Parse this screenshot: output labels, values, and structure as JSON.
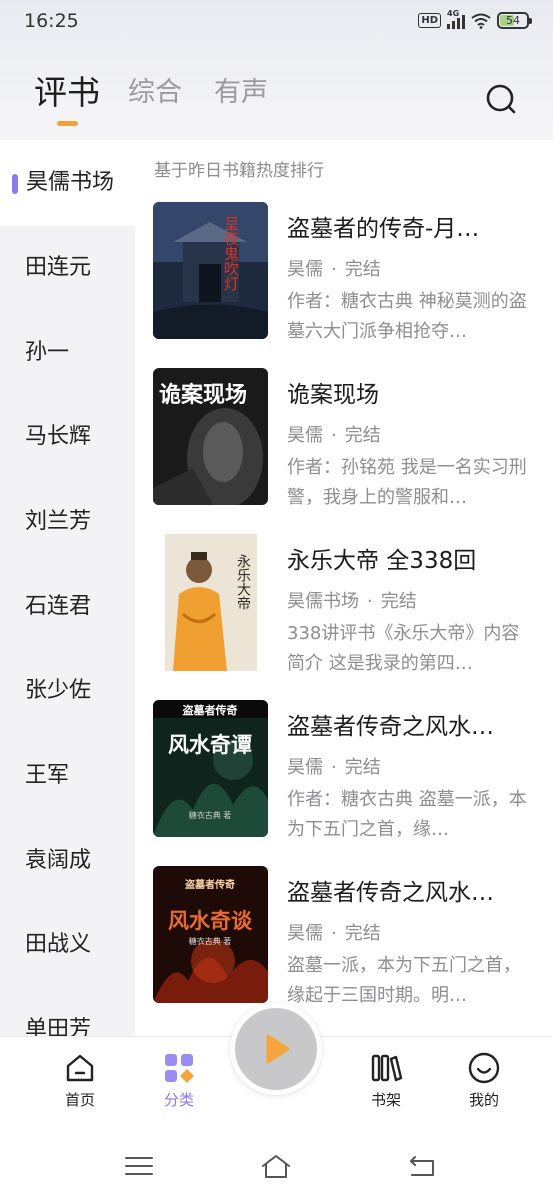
{
  "status_bar": {
    "time": "16:25",
    "hd": "HD",
    "network": "4G",
    "battery": "54",
    "battery_level": 0.54
  },
  "top_tabs": [
    {
      "label": "评书",
      "active": true
    },
    {
      "label": "综合",
      "active": false
    },
    {
      "label": "有声",
      "active": false
    }
  ],
  "colors": {
    "accent": "#8a78ee",
    "tab_indicator": "#f0a23e"
  },
  "subtitle": "基于昨日书籍热度排行",
  "sidebar": {
    "items": [
      {
        "label": "昊儒书场",
        "active": true
      },
      {
        "label": "田连元"
      },
      {
        "label": "孙一"
      },
      {
        "label": "马长辉"
      },
      {
        "label": "刘兰芳"
      },
      {
        "label": "石连君"
      },
      {
        "label": "张少佐"
      },
      {
        "label": "王军"
      },
      {
        "label": "袁阔成"
      },
      {
        "label": "田战义"
      },
      {
        "label": "单田芳"
      }
    ]
  },
  "books": [
    {
      "title": "盗墓者的传奇-月…",
      "author": "昊儒",
      "status": "完结",
      "desc": "作者：糖衣古典 神秘莫测的盗墓六大门派争相抢夺…",
      "cover_text": "呈夜鬼吹灯"
    },
    {
      "title": "诡案现场",
      "author": "昊儒",
      "status": "完结",
      "desc": "作者：孙铭苑 我是一名实习刑警，我身上的警服和…",
      "cover_text": "诡案现场"
    },
    {
      "title": "永乐大帝 全338回",
      "author": "昊儒书场",
      "status": "完结",
      "desc": "338讲评书《永乐大帝》内容简介 这是我录的第四…",
      "cover_text": "永乐大帝"
    },
    {
      "title": "盗墓者传奇之风水…",
      "author": "昊儒",
      "status": "完结",
      "desc": "作者：糖衣古典 盗墓一派，本为下五门之首，缘…",
      "cover_text_top": "盗墓者传奇",
      "cover_text": "风水奇谭",
      "cover_author": "糖衣古典 著"
    },
    {
      "title": "盗墓者传奇之风水…",
      "author": "昊儒",
      "status": "完结",
      "desc": "盗墓一派，本为下五门之首，缘起于三国时期。明…",
      "cover_text_top": "盗墓者传奇",
      "cover_text": "风水奇谈",
      "cover_author": "糖衣古典 著"
    }
  ],
  "meta_separator": "·",
  "bottom_nav": [
    {
      "label": "首页",
      "icon": "home-icon"
    },
    {
      "label": "分类",
      "icon": "category-icon",
      "active": true
    },
    {
      "label": "书架",
      "icon": "bookshelf-icon"
    },
    {
      "label": "我的",
      "icon": "profile-icon"
    }
  ],
  "player": {
    "icon": "play-icon"
  },
  "system_nav": [
    "menu-icon",
    "home-outline-icon",
    "back-icon"
  ]
}
